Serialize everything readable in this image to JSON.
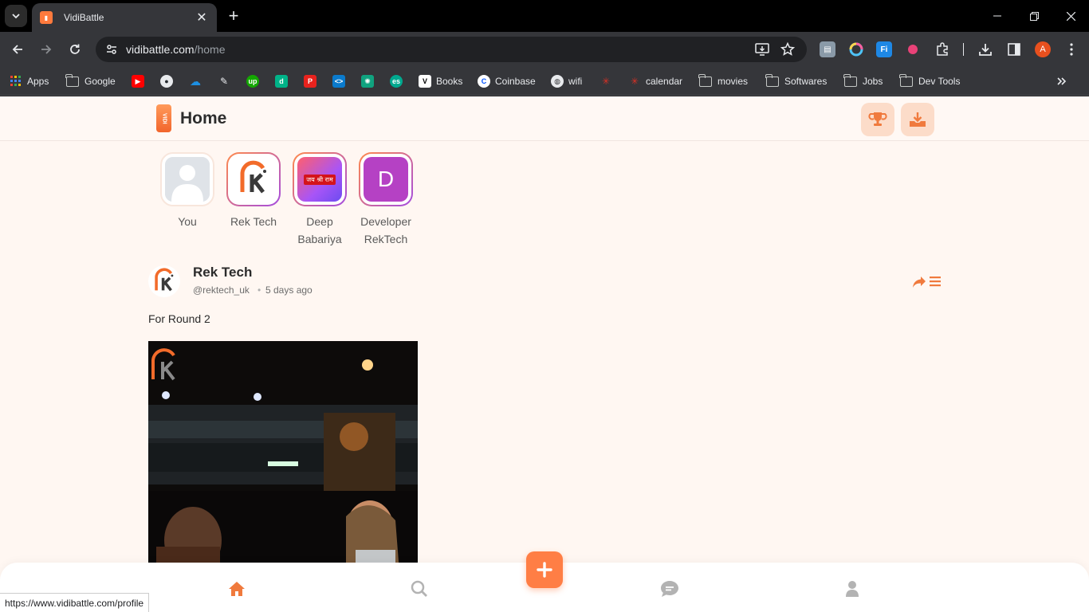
{
  "browser": {
    "tab_title": "VidiBattle",
    "url_host": "vidibattle.com",
    "url_path": "/home",
    "profile_initial": "A",
    "status_url": "https://www.vidibattle.com/profile"
  },
  "bookmarks": [
    {
      "label": "Apps",
      "icon": "apps-grid-icon"
    },
    {
      "label": "Google",
      "icon": "folder-icon"
    },
    {
      "label": "",
      "icon": "youtube-icon"
    },
    {
      "label": "",
      "icon": "github-icon"
    },
    {
      "label": "",
      "icon": "onedrive-icon"
    },
    {
      "label": "",
      "icon": "pen-icon"
    },
    {
      "label": "",
      "icon": "upwork-icon"
    },
    {
      "label": "",
      "icon": "d-icon"
    },
    {
      "label": "",
      "icon": "p-icon"
    },
    {
      "label": "",
      "icon": "vscode-icon"
    },
    {
      "label": "",
      "icon": "chatgpt-icon"
    },
    {
      "label": "",
      "icon": "es-icon"
    },
    {
      "label": "Books",
      "icon": "books-icon"
    },
    {
      "label": "Coinbase",
      "icon": "coinbase-icon"
    },
    {
      "label": "wifi",
      "icon": "globe-icon"
    },
    {
      "label": "",
      "icon": "red-app-icon"
    },
    {
      "label": "calendar",
      "icon": "red-app-icon"
    },
    {
      "label": "movies",
      "icon": "folder-icon"
    },
    {
      "label": "Softwares",
      "icon": "folder-icon"
    },
    {
      "label": "Jobs",
      "icon": "folder-icon"
    },
    {
      "label": "Dev Tools",
      "icon": "folder-icon"
    }
  ],
  "header": {
    "title": "Home",
    "logo_text": "VIDI"
  },
  "stories": [
    {
      "name": "You",
      "avatar": "default-user"
    },
    {
      "name": "Rek Tech",
      "avatar": "rektech-logo"
    },
    {
      "name": "Deep Babariya",
      "avatar": "jai-shri-ram-banner",
      "banner_text": "जय श्री राम"
    },
    {
      "name": "Developer RekTech",
      "avatar": "letter",
      "initial": "D"
    }
  ],
  "post": {
    "author": "Rek Tech",
    "handle": "@rektech_uk",
    "separator": "•",
    "time": "5 days ago",
    "caption": "For Round 2"
  },
  "colors": {
    "accent": "#ff7e45",
    "accent_light": "#fcdcc9",
    "page_bg": "#fff7f2"
  }
}
